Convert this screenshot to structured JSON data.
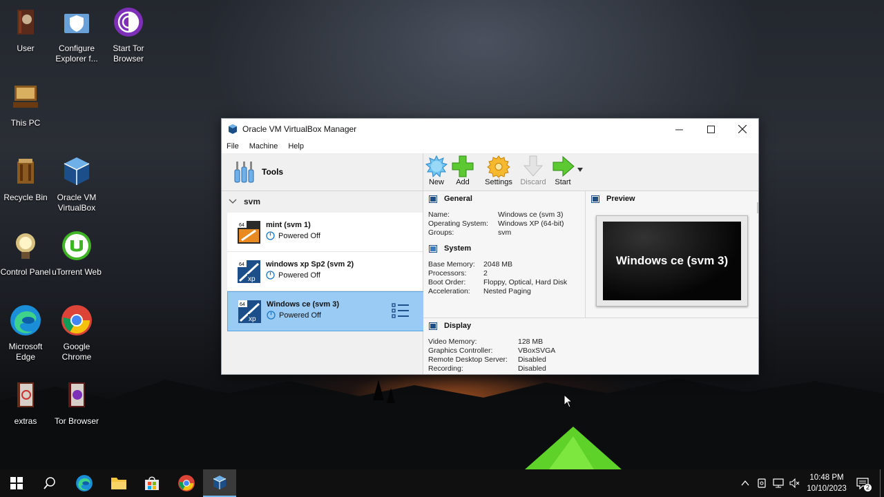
{
  "desktop": {
    "icons": [
      {
        "label": "User",
        "icon": "user-folder-icon"
      },
      {
        "label": "Configure Explorer f...",
        "icon": "shield-folder-icon"
      },
      {
        "label": "Start Tor Browser",
        "icon": "tor-onion-icon"
      },
      {
        "label": "This PC",
        "icon": "computer-icon"
      },
      {
        "label": "Recycle Bin",
        "icon": "recycle-bin-icon"
      },
      {
        "label": "Oracle VM VirtualBox",
        "icon": "virtualbox-icon"
      },
      {
        "label": "Control Panel",
        "icon": "lightbulb-icon"
      },
      {
        "label": "uTorrent Web",
        "icon": "utorrent-icon"
      },
      {
        "label": "Microsoft Edge",
        "icon": "edge-icon"
      },
      {
        "label": "Google Chrome",
        "icon": "chrome-icon"
      },
      {
        "label": "extras",
        "icon": "book-icon"
      },
      {
        "label": "Tor Browser",
        "icon": "tor-book-icon"
      }
    ]
  },
  "window": {
    "title": "Oracle VM VirtualBox Manager",
    "menu": [
      "File",
      "Machine",
      "Help"
    ],
    "tools_label": "Tools",
    "group_name": "svm",
    "vms": [
      {
        "name": "mint (svm 1)",
        "state": "Powered Off",
        "selected": false
      },
      {
        "name": "windows xp Sp2 (svm 2)",
        "state": "Powered Off",
        "selected": false
      },
      {
        "name": "Windows ce (svm 3)",
        "state": "Powered Off",
        "selected": true
      }
    ],
    "toolbar": {
      "new": "New",
      "add": "Add",
      "settings": "Settings",
      "discard": "Discard",
      "start": "Start"
    },
    "general": {
      "title": "General",
      "rows": [
        {
          "k": "Name:",
          "v": "Windows ce (svm 3)"
        },
        {
          "k": "Operating System:",
          "v": "Windows XP (64-bit)"
        },
        {
          "k": "Groups:",
          "v": "svm"
        }
      ]
    },
    "system": {
      "title": "System",
      "rows": [
        {
          "k": "Base Memory:",
          "v": "2048 MB"
        },
        {
          "k": "Processors:",
          "v": "2"
        },
        {
          "k": "Boot Order:",
          "v": "Floppy, Optical, Hard Disk"
        },
        {
          "k": "Acceleration:",
          "v": "Nested Paging"
        }
      ]
    },
    "display": {
      "title": "Display",
      "rows": [
        {
          "k": "Video Memory:",
          "v": "128 MB"
        },
        {
          "k": "Graphics Controller:",
          "v": "VBoxSVGA"
        },
        {
          "k": "Remote Desktop Server:",
          "v": "Disabled"
        },
        {
          "k": "Recording:",
          "v": "Disabled"
        }
      ]
    },
    "preview": {
      "title": "Preview",
      "screen_text": "Windows ce (svm 3)"
    }
  },
  "taskbar": {
    "time": "10:48 PM",
    "date": "10/10/2023",
    "notifications_count": "2"
  },
  "colors": {
    "selection": "#99cbf5",
    "taskbar": "#101010",
    "accent_blue": "#1e78c8"
  }
}
